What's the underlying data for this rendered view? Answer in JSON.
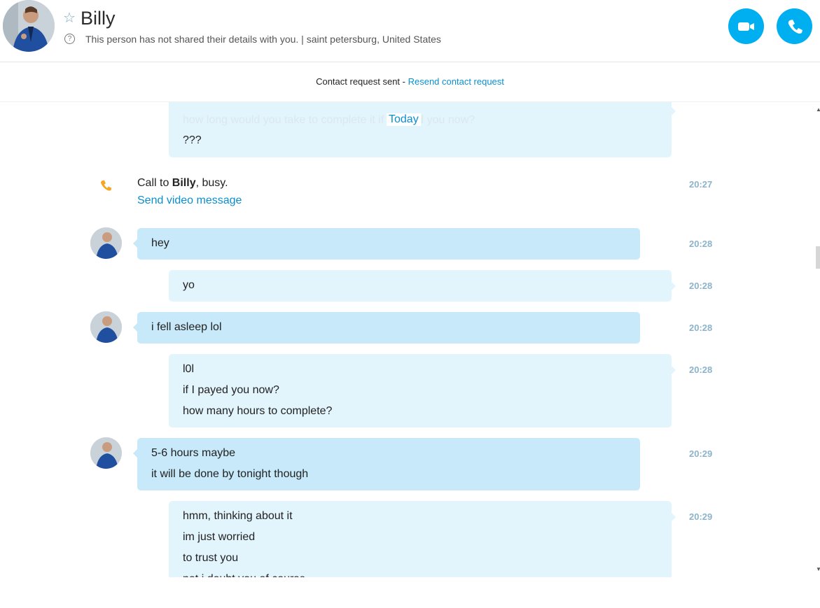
{
  "header": {
    "contact_name": "Billy",
    "favorite_icon": "star-outline-icon",
    "info_icon_glyph": "?",
    "details_text": "This person has not shared their details with you.  |  saint petersburg, United States",
    "video_call_icon": "video-camera-icon",
    "audio_call_icon": "phone-icon",
    "accent_color": "#00aff0"
  },
  "contact_request": {
    "status_text": "Contact request sent - ",
    "resend_link": "Resend contact request"
  },
  "chat": {
    "date_divider": "Today",
    "faded_previous_text": "how long would you take to complete it if I payed you now?",
    "messages": [
      {
        "from": "me",
        "lines": [
          "???"
        ]
      },
      {
        "type": "call",
        "text_prefix": "Call to ",
        "contact": "Billy",
        "text_suffix": ", busy.",
        "action": "Send video message",
        "time": "20:27"
      },
      {
        "from": "Billy",
        "lines": [
          "hey"
        ],
        "time": "20:28"
      },
      {
        "from": "me",
        "lines": [
          "yo"
        ],
        "time": "20:28"
      },
      {
        "from": "Billy",
        "lines": [
          "i fell asleep lol"
        ],
        "time": "20:28"
      },
      {
        "from": "me",
        "lines": [
          "l0l",
          "if I payed you now?",
          "how many hours to complete?"
        ],
        "time": "20:28"
      },
      {
        "from": "Billy",
        "lines": [
          "5-6 hours maybe",
          "it will be done by tonight though"
        ],
        "time": "20:29"
      },
      {
        "from": "me",
        "lines": [
          "hmm, thinking about it",
          "im just worried",
          "to trust you",
          "not i doubt you of course"
        ],
        "time": "20:29"
      }
    ],
    "incoming_bubble_color": "#c7e9f9",
    "outgoing_bubble_color": "#e2f4fc",
    "link_color": "#0a8fd0",
    "call_icon_color": "#f5a623"
  }
}
